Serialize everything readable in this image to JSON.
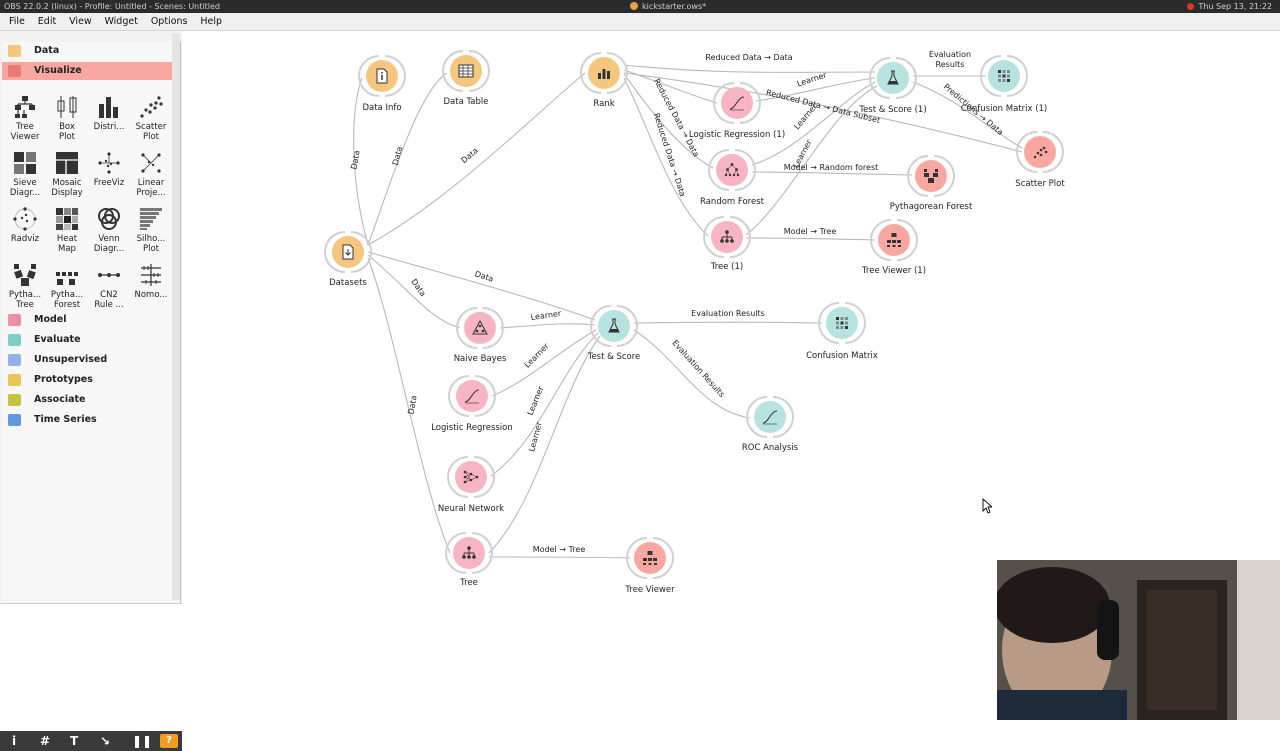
{
  "topbar": {
    "left_text": "OBS 22.0.2 (linux) - Profile: Untitled - Scenes: Untitled",
    "center_text": "kickstarter.ows*",
    "right_text": "Thu Sep 13, 21:22"
  },
  "menu": [
    "File",
    "Edit",
    "View",
    "Widget",
    "Options",
    "Help"
  ],
  "sidebar": {
    "categories": [
      {
        "label": "Data",
        "color": "#f5c77e"
      },
      {
        "label": "Visualize",
        "color": "#f9a8a1"
      },
      {
        "label": "Model",
        "color": "#f7b4c2"
      },
      {
        "label": "Evaluate",
        "color": "#b6e3df"
      },
      {
        "label": "Unsupervised",
        "color": "#c4d4f2"
      },
      {
        "label": "Prototypes",
        "color": "#f7d88c"
      },
      {
        "label": "Associate",
        "color": "#d9d86f"
      },
      {
        "label": "Time Series",
        "color": "#9dc2f0"
      }
    ],
    "widgets": [
      {
        "label": "Tree\nViewer",
        "icon": "tree-viewer-icon"
      },
      {
        "label": "Box\nPlot",
        "icon": "box-plot-icon"
      },
      {
        "label": "Distri...",
        "icon": "distributions-icon"
      },
      {
        "label": "Scatter\nPlot",
        "icon": "scatter-plot-icon"
      },
      {
        "label": "Sieve\nDiagr...",
        "icon": "sieve-diagram-icon"
      },
      {
        "label": "Mosaic\nDisplay",
        "icon": "mosaic-display-icon"
      },
      {
        "label": "FreeViz",
        "icon": "freeviz-icon"
      },
      {
        "label": "Linear\nProje...",
        "icon": "linear-projection-icon"
      },
      {
        "label": "Radviz",
        "icon": "radviz-icon"
      },
      {
        "label": "Heat\nMap",
        "icon": "heat-map-icon"
      },
      {
        "label": "Venn\nDiagr...",
        "icon": "venn-diagram-icon"
      },
      {
        "label": "Silho...\nPlot",
        "icon": "silhouette-plot-icon"
      },
      {
        "label": "Pytha...\nTree",
        "icon": "pythagorean-tree-icon"
      },
      {
        "label": "Pytha...\nForest",
        "icon": "pythagorean-forest-icon"
      },
      {
        "label": "CN2\nRule ...",
        "icon": "cn2-rule-viewer-icon"
      },
      {
        "label": "Nomo...",
        "icon": "nomogram-icon"
      }
    ]
  },
  "colors": {
    "data": "#f5c77e",
    "visualize": "#f9a8a1",
    "model": "#f7b4c2",
    "evaluate": "#b6e3df",
    "unsupervised": "#c4d4f2"
  },
  "nodes": {
    "datasets": "Datasets",
    "data_info": "Data Info",
    "data_table": "Data Table",
    "rank": "Rank",
    "logreg1": "Logistic Regression (1)",
    "rf": "Random Forest",
    "tree1": "Tree (1)",
    "ts1": "Test & Score (1)",
    "cm1": "Confusion Matrix (1)",
    "scatter": "Scatter Plot",
    "pyth": "Pythagorean Forest",
    "tv1": "Tree Viewer (1)",
    "nb": "Naive Bayes",
    "logreg": "Logistic Regression",
    "nn": "Neural Network",
    "tree": "Tree",
    "ts": "Test & Score",
    "cm": "Confusion Matrix",
    "roc": "ROC Analysis",
    "tv": "Tree Viewer"
  },
  "links": {
    "data": "Data",
    "learner": "Learner",
    "eval": "Evaluation Results",
    "eval_split": "Evaluation\nResults",
    "model_tree": "Model → Tree",
    "model_rf": "Model → Random forest",
    "reduced": "Reduced Data → Data",
    "reduced_subset": "Reduced Data → Data Subset",
    "predictions": "Predictions → Data"
  }
}
